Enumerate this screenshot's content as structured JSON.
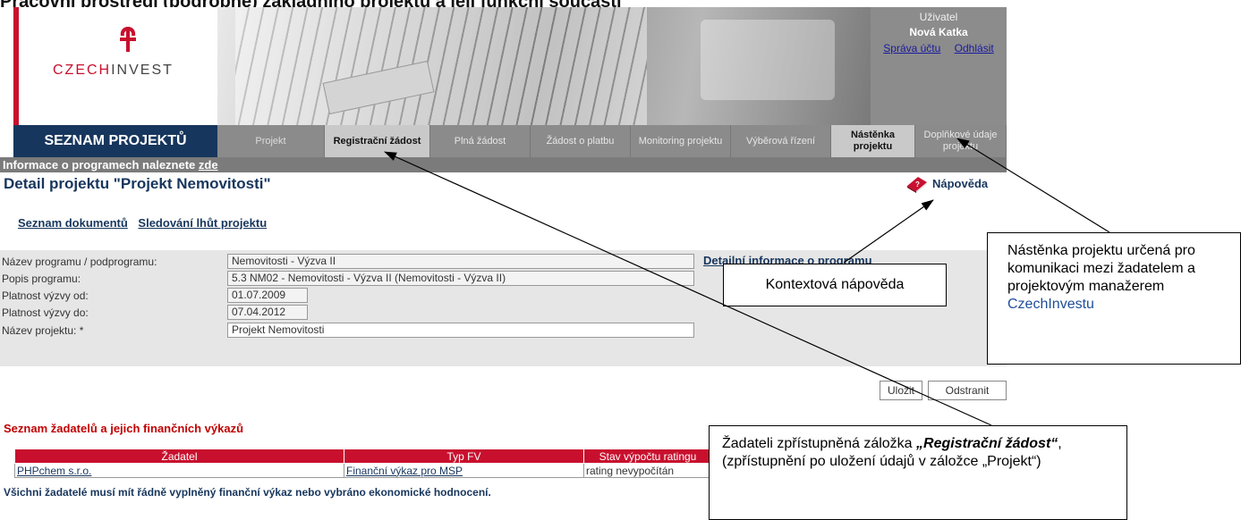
{
  "doc_heading": "Pracovní prostředí (podrobné) základního projektu a její funkční součásti",
  "header": {
    "logo_text_czech": "CZECH",
    "logo_text_invest": "INVEST",
    "user_label": "Uživatel",
    "user_name": "Nová Katka",
    "account_link": "Správa účtu",
    "logout_link": "Odhlásit"
  },
  "nav": {
    "projects_label": "SEZNAM PROJEKTŮ",
    "tabs": [
      {
        "label": "Projekt"
      },
      {
        "label": "Registrační žádost"
      },
      {
        "label": "Plná žádost"
      },
      {
        "label": "Žádost o platbu"
      },
      {
        "label": "Monitoring projektu"
      },
      {
        "label": "Výběrová řízení"
      },
      {
        "label": "Nástěnka projektu"
      },
      {
        "label": "Doplňkové údaje projektu"
      }
    ]
  },
  "info_bar": {
    "text": "Informace o programech naleznete ",
    "link": "zde"
  },
  "detail": {
    "title": "Detail projektu  \"Projekt Nemovitosti\"",
    "help_label": "Nápověda",
    "doc_list_link": "Seznam dokumentů",
    "deadlines_link": "Sledování lhůt projektu",
    "program_info_link": "Detailní informace o programu"
  },
  "form": {
    "fields": [
      {
        "label": "Název programu / podprogramu:",
        "value": "Nemovitosti - Výzva II"
      },
      {
        "label": "Popis programu:",
        "value": "5.3 NM02 - Nemovitosti - Výzva II (Nemovitosti - Výzva II)"
      },
      {
        "label": "Platnost výzvy od:",
        "value": "01.07.2009"
      },
      {
        "label": "Platnost výzvy do:",
        "value": "07.04.2012"
      },
      {
        "label": "Název projektu: *",
        "value": "Projekt Nemovitosti"
      }
    ],
    "save_button": "Uložit",
    "delete_button": "Odstranit"
  },
  "applicants": {
    "title": "Seznam žadatelů a jejich finančních výkazů",
    "columns": [
      "Žadatel",
      "Typ FV",
      "Stav výpočtu ratingu"
    ],
    "rows": [
      [
        "PHPchem s.r.o.",
        "Finanční výkaz pro MSP",
        "rating nevypočítán"
      ]
    ],
    "note": "Všichni žadatelé musí mít řádně vyplněný finanční výkaz nebo vybráno ekonomické hodnocení."
  },
  "callouts": {
    "help": "Kontextová nápověda",
    "board_main": "Nástěnka projektu určená pro komunikaci mezi žadatelem a projektovým manažerem",
    "board_brand": "CzechInvestu",
    "reg_prefix": "Žadateli zpřístupněná záložka ",
    "reg_quote_open": "„",
    "reg_bold": "Registrační žádost",
    "reg_quote_close": "“",
    "reg_suffix": ", (zpřístupnění po uložení údajů v záložce „Projekt“)"
  },
  "colors": {
    "brand_red": "#c8102e",
    "nav_dark": "#17365d",
    "tab_gray": "#8b8b8b"
  }
}
